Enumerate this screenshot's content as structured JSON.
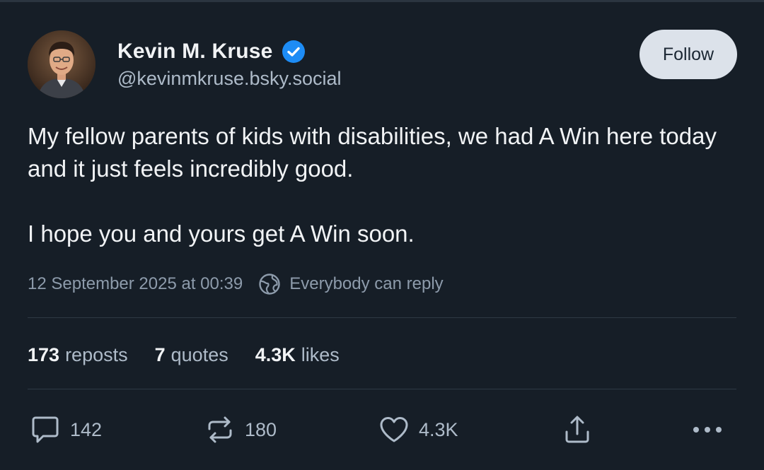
{
  "author": {
    "display_name": "Kevin M. Kruse",
    "handle": "@kevinmkruse.bsky.social",
    "verified_icon": "verified-check-icon"
  },
  "follow_button": {
    "label": "Follow"
  },
  "post": {
    "paragraphs": [
      "My fellow parents of kids with disabilities, we had A Win here today and it just feels incredibly good.",
      "I hope you and yours get A Win soon."
    ],
    "timestamp": "12 September 2025 at 00:39",
    "reply_setting": "Everybody can reply"
  },
  "stats": {
    "reposts": {
      "count": "173",
      "label": "reposts"
    },
    "quotes": {
      "count": "7",
      "label": "quotes"
    },
    "likes": {
      "count": "4.3K",
      "label": "likes"
    }
  },
  "actions": {
    "reply": {
      "icon": "reply-bubble-icon",
      "count": "142"
    },
    "repost": {
      "icon": "repost-icon",
      "count": "180"
    },
    "like": {
      "icon": "heart-icon",
      "count": "4.3K"
    },
    "share": {
      "icon": "share-icon"
    },
    "more": {
      "icon": "more-dots-icon"
    }
  },
  "colors": {
    "background": "#161e27",
    "text_primary": "#f1f3f5",
    "text_secondary": "#aebbc9",
    "text_muted": "#8d9bab",
    "verified": "#1d8cf5",
    "follow_button_bg": "#dce2ea"
  }
}
